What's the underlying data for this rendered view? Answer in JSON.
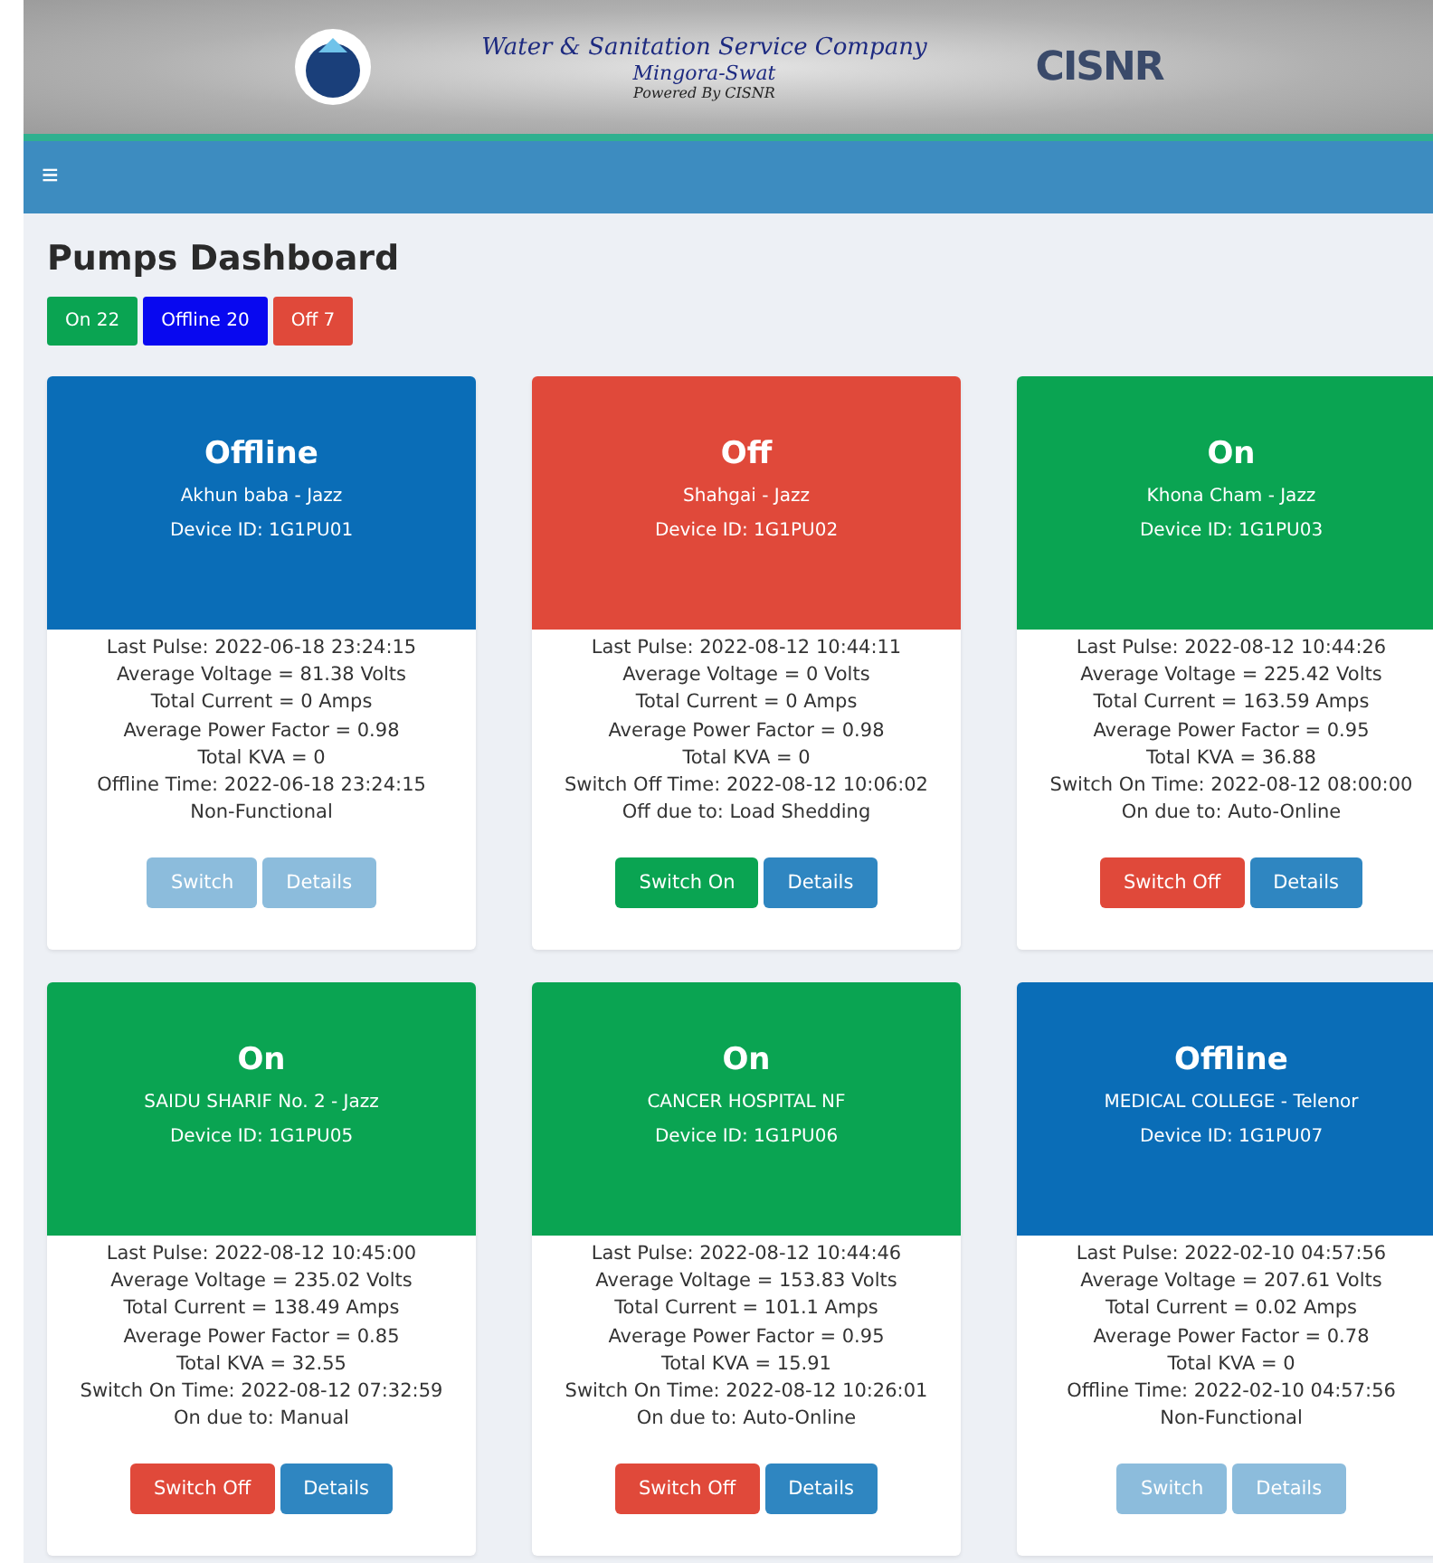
{
  "banner": {
    "title": "Water & Sanitation Service Company",
    "subtitle": "Mingora-Swat",
    "powered_by": "Powered By CISNR",
    "partner_logo": "CISNR"
  },
  "navbar": {
    "menu_icon": "≡"
  },
  "page_title": "Pumps Dashboard",
  "summary": [
    {
      "label": "On 22",
      "kind": "on"
    },
    {
      "label": "Offline 20",
      "kind": "offline"
    },
    {
      "label": "Off 7",
      "kind": "off"
    }
  ],
  "pumps": [
    {
      "status": "Offline",
      "kind": "offline",
      "name": "Akhun baba - Jazz",
      "device_id": "Device ID: 1G1PU01",
      "details": [
        "Last Pulse: 2022-06-18 23:24:15",
        "Average Voltage = 81.38 Volts",
        "Total Current = 0 Amps",
        "Average Power Factor = 0.98",
        "Total KVA = 0",
        "Offline Time: 2022-06-18 23:24:15",
        "Non-Functional"
      ],
      "switch": {
        "label": "Switch",
        "kind": "none",
        "disabled": true
      },
      "details_button": {
        "label": "Details",
        "disabled": true
      }
    },
    {
      "status": "Off",
      "kind": "off",
      "name": "Shahgai - Jazz",
      "device_id": "Device ID: 1G1PU02",
      "details": [
        "Last Pulse: 2022-08-12 10:44:11",
        "Average Voltage = 0 Volts",
        "Total Current = 0 Amps",
        "Average Power Factor = 0.98",
        "Total KVA = 0",
        "Switch Off Time: 2022-08-12 10:06:02",
        "Off due to: Load Shedding"
      ],
      "switch": {
        "label": "Switch On",
        "kind": "on",
        "disabled": false
      },
      "details_button": {
        "label": "Details",
        "disabled": false
      }
    },
    {
      "status": "On",
      "kind": "on",
      "name": "Khona Cham - Jazz",
      "device_id": "Device ID: 1G1PU03",
      "details": [
        "Last Pulse: 2022-08-12 10:44:26",
        "Average Voltage = 225.42 Volts",
        "Total Current = 163.59 Amps",
        "Average Power Factor = 0.95",
        "Total KVA = 36.88",
        "Switch On Time: 2022-08-12 08:00:00",
        "On due to: Auto-Online"
      ],
      "switch": {
        "label": "Switch Off",
        "kind": "off",
        "disabled": false
      },
      "details_button": {
        "label": "Details",
        "disabled": false
      }
    },
    {
      "status": "On",
      "kind": "on",
      "name": "SAIDU SHARIF No. 2 - Jazz",
      "device_id": "Device ID: 1G1PU05",
      "details": [
        "Last Pulse: 2022-08-12 10:45:00",
        "Average Voltage = 235.02 Volts",
        "Total Current = 138.49 Amps",
        "Average Power Factor = 0.85",
        "Total KVA = 32.55",
        "Switch On Time: 2022-08-12 07:32:59",
        "On due to: Manual"
      ],
      "switch": {
        "label": "Switch Off",
        "kind": "off",
        "disabled": false
      },
      "details_button": {
        "label": "Details",
        "disabled": false
      }
    },
    {
      "status": "On",
      "kind": "on",
      "name": "CANCER HOSPITAL NF",
      "device_id": "Device ID: 1G1PU06",
      "details": [
        "Last Pulse: 2022-08-12 10:44:46",
        "Average Voltage = 153.83 Volts",
        "Total Current = 101.1 Amps",
        "Average Power Factor = 0.95",
        "Total KVA = 15.91",
        "Switch On Time: 2022-08-12 10:26:01",
        "On due to: Auto-Online"
      ],
      "switch": {
        "label": "Switch Off",
        "kind": "off",
        "disabled": false
      },
      "details_button": {
        "label": "Details",
        "disabled": false
      }
    },
    {
      "status": "Offline",
      "kind": "offline",
      "name": "MEDICAL COLLEGE - Telenor",
      "device_id": "Device ID: 1G1PU07",
      "details": [
        "Last Pulse: 2022-02-10 04:57:56",
        "Average Voltage = 207.61 Volts",
        "Total Current = 0.02 Amps",
        "Average Power Factor = 0.78",
        "Total KVA = 0",
        "Offline Time: 2022-02-10 04:57:56",
        "Non-Functional"
      ],
      "switch": {
        "label": "Switch",
        "kind": "none",
        "disabled": true
      },
      "details_button": {
        "label": "Details",
        "disabled": true
      }
    }
  ]
}
